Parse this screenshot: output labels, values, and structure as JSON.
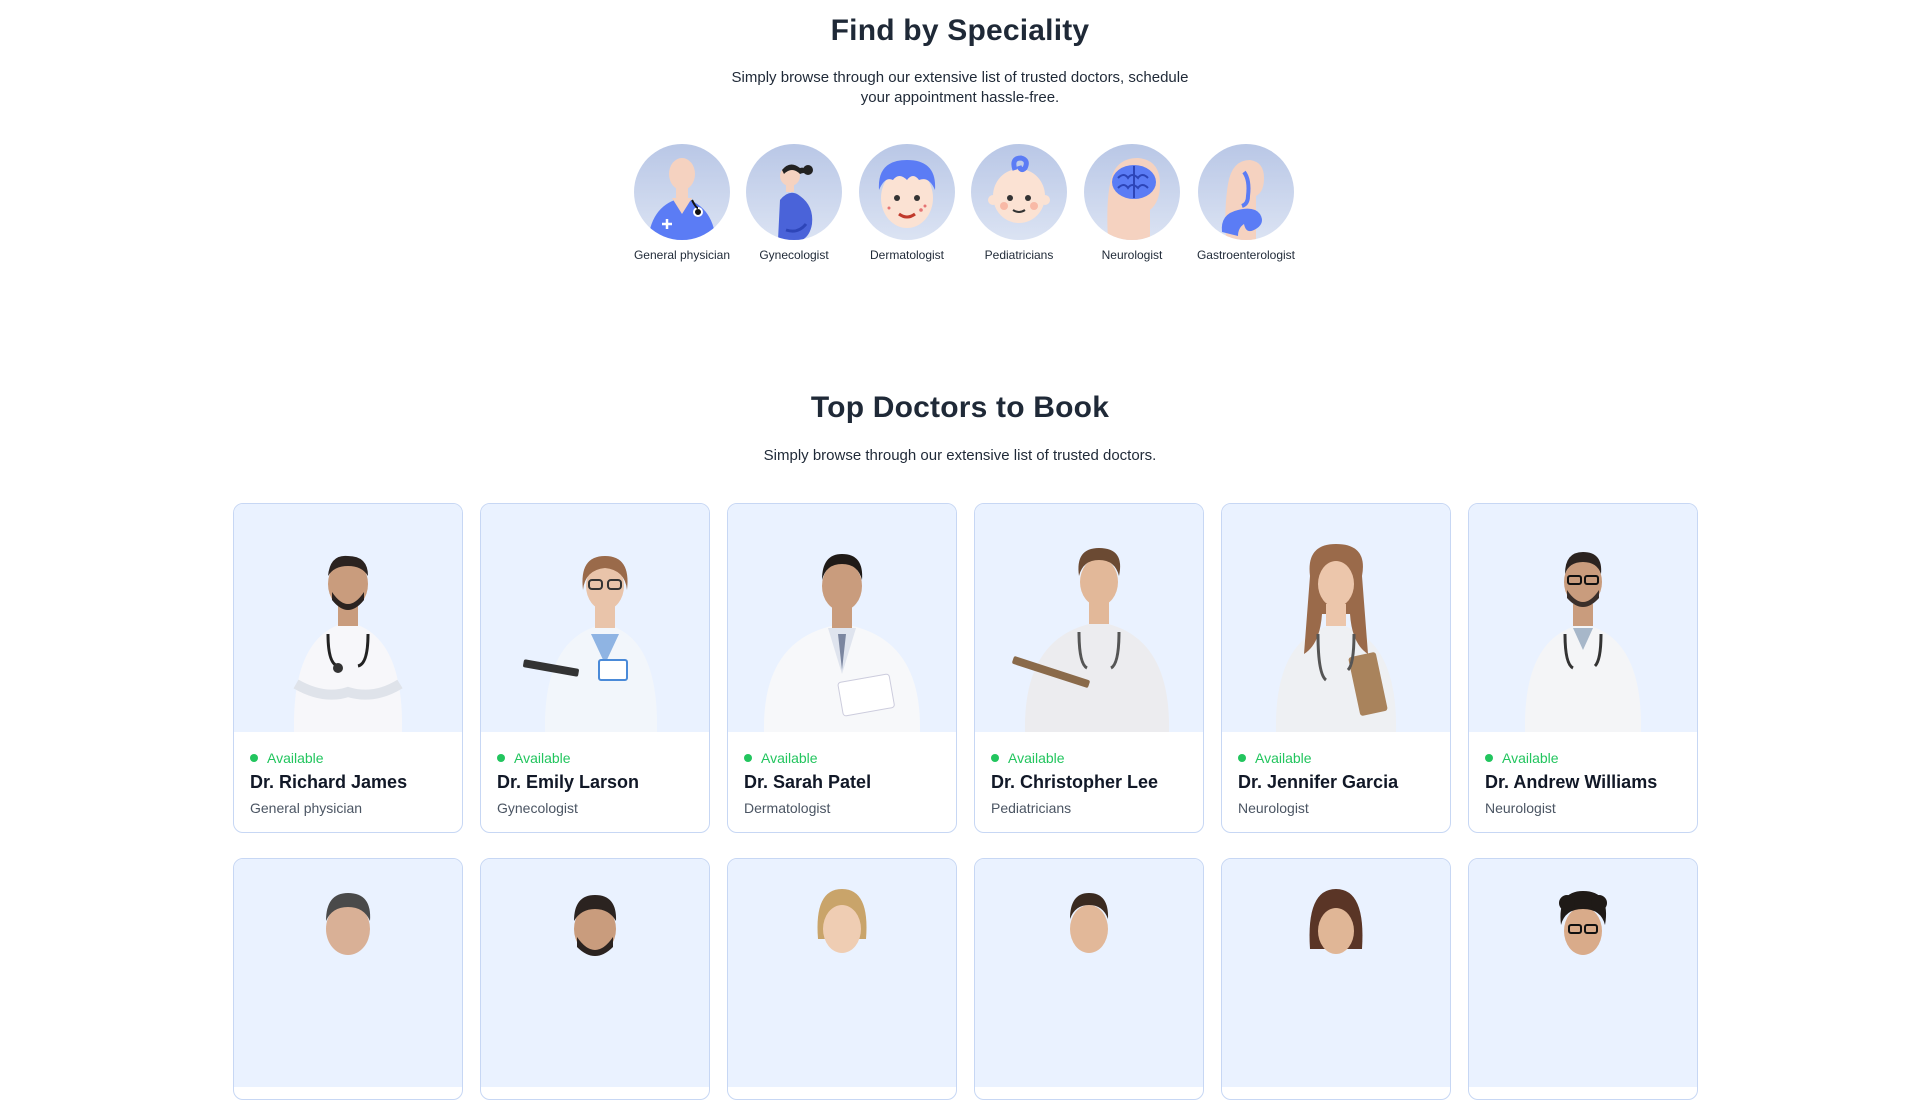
{
  "speciality": {
    "title": "Find by Speciality",
    "subtitle": "Simply browse through our extensive list of trusted doctors, schedule your appointment hassle-free.",
    "items": [
      {
        "label": "General physician",
        "icon": "general-physician-icon"
      },
      {
        "label": "Gynecologist",
        "icon": "gynecologist-icon"
      },
      {
        "label": "Dermatologist",
        "icon": "dermatologist-icon"
      },
      {
        "label": "Pediatricians",
        "icon": "pediatricians-icon"
      },
      {
        "label": "Neurologist",
        "icon": "neurologist-icon"
      },
      {
        "label": "Gastroenterologist",
        "icon": "gastroenterologist-icon"
      }
    ]
  },
  "top_doctors": {
    "title": "Top Doctors to Book",
    "subtitle": "Simply browse through our extensive list of trusted doctors.",
    "doctors": [
      {
        "status": "Available",
        "name": "Dr. Richard James",
        "speciality": "General physician"
      },
      {
        "status": "Available",
        "name": "Dr. Emily Larson",
        "speciality": "Gynecologist"
      },
      {
        "status": "Available",
        "name": "Dr. Sarah Patel",
        "speciality": "Dermatologist"
      },
      {
        "status": "Available",
        "name": "Dr. Christopher Lee",
        "speciality": "Pediatricians"
      },
      {
        "status": "Available",
        "name": "Dr. Jennifer Garcia",
        "speciality": "Neurologist"
      },
      {
        "status": "Available",
        "name": "Dr. Andrew Williams",
        "speciality": "Neurologist"
      }
    ]
  },
  "colors": {
    "available": "#22c55e",
    "card_border": "#c7d7f4",
    "photo_bg": "#eaf2ff",
    "icon_blue": "#5b7cf5"
  }
}
